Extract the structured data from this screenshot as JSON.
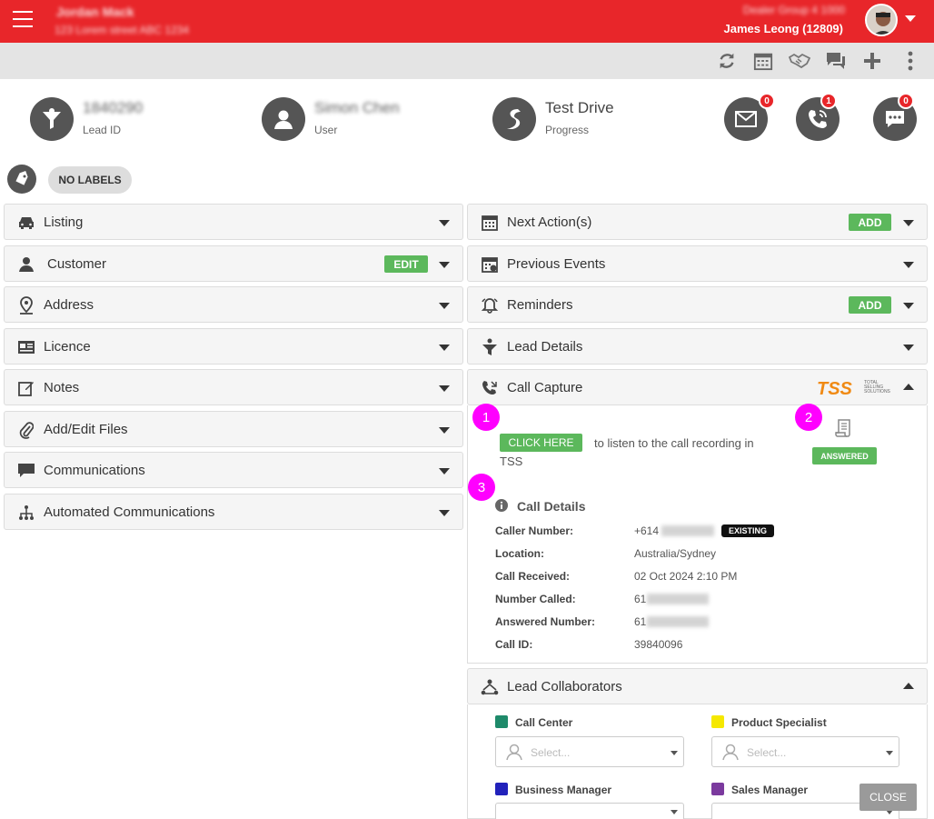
{
  "topbar": {
    "dealer_name": "Jordan Mack",
    "dealer_sub": "123 Lorem street ABC 1234",
    "location_line": "Dealer Group 4 1000",
    "user_name": "James Leong (12809)"
  },
  "summary": {
    "lead_id_value": "1840290",
    "lead_id_label": "Lead ID",
    "user_value": "Simon Chen",
    "user_label": "User",
    "progress_value": "Test Drive",
    "progress_label": "Progress",
    "email_count": "0",
    "call_count": "1",
    "chat_count": "0"
  },
  "labels": {
    "no_labels": "NO LABELS"
  },
  "left_panels": [
    {
      "title": "Listing"
    },
    {
      "title": "Customer",
      "action": "EDIT"
    },
    {
      "title": "Address"
    },
    {
      "title": "Licence"
    },
    {
      "title": "Notes"
    },
    {
      "title": "Add/Edit Files"
    },
    {
      "title": "Communications"
    },
    {
      "title": "Automated Communications"
    }
  ],
  "right_panels": [
    {
      "title": "Next Action(s)",
      "action": "ADD"
    },
    {
      "title": "Previous Events"
    },
    {
      "title": "Reminders",
      "action": "ADD"
    },
    {
      "title": "Lead Details"
    },
    {
      "title": "Call Capture"
    }
  ],
  "call_capture": {
    "tss_logo": "TSS",
    "tss_logo_sub": "TOTAL SELLING SOLUTIONS",
    "marker1": "1",
    "marker2": "2",
    "marker3": "3",
    "click_here": "CLICK HERE",
    "listen_text": "to listen to the call recording in",
    "listen_text2": "TSS",
    "answered": "ANSWERED",
    "details_title": "Call Details",
    "rows": [
      {
        "label": "Caller Number:",
        "value": "+614"
      },
      {
        "label": "Location:",
        "value": "Australia/Sydney"
      },
      {
        "label": "Call Received:",
        "value": "02 Oct 2024 2:10 PM"
      },
      {
        "label": "Number Called:",
        "value": "61"
      },
      {
        "label": "Answered Number:",
        "value": "61"
      },
      {
        "label": "Call ID:",
        "value": "39840096"
      }
    ],
    "existing_badge": "EXISTING"
  },
  "collaborators": {
    "title": "Lead Collaborators",
    "roles": [
      {
        "name": "Call Center",
        "color": "#1e8a6a"
      },
      {
        "name": "Product Specialist",
        "color": "#f5e800"
      },
      {
        "name": "Business Manager",
        "color": "#2222bb"
      },
      {
        "name": "Sales Manager",
        "color": "#7b3a9e"
      }
    ],
    "select_placeholder": "Select..."
  },
  "close_label": "CLOSE"
}
